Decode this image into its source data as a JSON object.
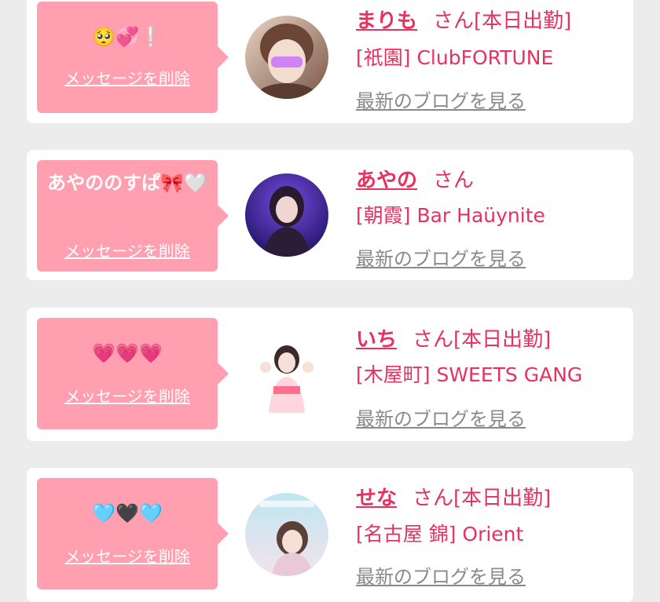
{
  "conversations": [
    {
      "message": "🥺💞❕",
      "delete_label": "メッセージを削除",
      "name": "まりも",
      "honorific": "さん",
      "status": "[本日出勤]",
      "shop": "[祇園] ClubFORTUNE",
      "blog_link": "最新のブログを見る"
    },
    {
      "message": "あやののすぱ🎀🤍",
      "delete_label": "メッセージを削除",
      "name": "あやの",
      "honorific": "さん",
      "status": "",
      "shop": "[朝霞] Bar Haüynite",
      "blog_link": "最新のブログを見る"
    },
    {
      "message": "💗💗💗",
      "delete_label": "メッセージを削除",
      "name": "いち",
      "honorific": "さん",
      "status": "[本日出勤]",
      "shop": "[木屋町] SWEETS GANG",
      "blog_link": "最新のブログを見る"
    },
    {
      "message": "🩵🖤🩵",
      "delete_label": "メッセージを削除",
      "name": "せな",
      "honorific": "さん",
      "status": "[本日出勤]",
      "shop": "[名古屋 錦] Orient",
      "blog_link": "最新のブログを見る"
    }
  ],
  "colors": {
    "page_background": "#ececec",
    "card_background": "#ffffff",
    "bubble_pink": "#ff9fb0",
    "accent_text": "#e6325f",
    "link_gray": "#8a8a8a"
  }
}
